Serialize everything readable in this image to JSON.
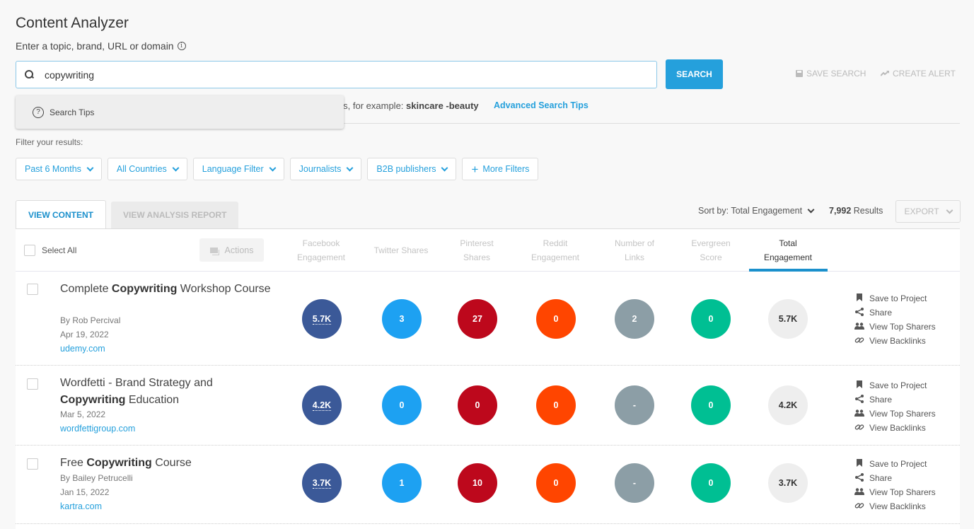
{
  "header": {
    "title": "Content Analyzer",
    "subtitle": "Enter a topic, brand, URL or domain",
    "info_icon": "i"
  },
  "search": {
    "value": "copywriting",
    "placeholder": "",
    "button_label": "SEARCH",
    "save_search_label": "SAVE SEARCH",
    "create_alert_label": "CREATE ALERT",
    "dropdown_item": "Search Tips",
    "tips_prefix": "rms, for example: ",
    "tips_example": "skincare -beauty",
    "advanced_tips_link": "Advanced Search Tips"
  },
  "filters": {
    "label": "Filter your results:",
    "items": [
      {
        "label": "Past 6 Months",
        "type": "dropdown"
      },
      {
        "label": "All Countries",
        "type": "dropdown"
      },
      {
        "label": "Language Filter",
        "type": "dropdown"
      },
      {
        "label": "Journalists",
        "type": "dropdown"
      },
      {
        "label": "B2B publishers",
        "type": "dropdown"
      },
      {
        "label": "More Filters",
        "type": "add"
      }
    ]
  },
  "tabs": [
    {
      "label": "VIEW CONTENT",
      "active": true
    },
    {
      "label": "VIEW ANALYSIS REPORT",
      "active": false
    }
  ],
  "toolbar": {
    "sort_by": "Sort by: Total Engagement",
    "results_count": "7,992",
    "results_label": " Results",
    "export_label": "EXPORT"
  },
  "table": {
    "select_all": "Select All",
    "actions_label": "Actions",
    "columns": [
      {
        "line1": "Facebook",
        "line2": "Engagement",
        "color": "#3b5998"
      },
      {
        "line1": "Twitter Shares",
        "line2": "",
        "color": "#1da1f2"
      },
      {
        "line1": "Pinterest",
        "line2": "Shares",
        "color": "#bd081c"
      },
      {
        "line1": "Reddit",
        "line2": "Engagement",
        "color": "#ff4500"
      },
      {
        "line1": "Number of",
        "line2": "Links",
        "color": "#8c9ea6"
      },
      {
        "line1": "Evergreen",
        "line2": "Score",
        "color": "#00bf93"
      },
      {
        "line1": "Total",
        "line2": "Engagement",
        "color": "#eeeeee"
      }
    ],
    "row_actions": [
      "Save to Project",
      "Share",
      "View Top Sharers",
      "View Backlinks"
    ],
    "rows": [
      {
        "title_pre": "Complete ",
        "title_bold": "Copywriting",
        "title_post": " Workshop Course",
        "author": "By  Rob Percival",
        "date": "Apr 19, 2022",
        "domain": "udemy.com",
        "values": [
          "5.7K",
          "3",
          "27",
          "0",
          "2",
          "0",
          "5.7K"
        ]
      },
      {
        "title_pre": "Wordfetti - Brand Strategy and ",
        "title_bold": "Copywriting",
        "title_post": " Education",
        "author": "",
        "date": "Mar 5, 2022",
        "domain": "wordfettigroup.com",
        "values": [
          "4.2K",
          "0",
          "0",
          "0",
          "-",
          "0",
          "4.2K"
        ]
      },
      {
        "title_pre": "Free ",
        "title_bold": "Copywriting",
        "title_post": " Course",
        "author": "By  Bailey Petrucelli",
        "date": "Jan 15, 2022",
        "domain": "kartra.com",
        "values": [
          "3.7K",
          "1",
          "10",
          "0",
          "-",
          "0",
          "3.7K"
        ]
      }
    ]
  }
}
